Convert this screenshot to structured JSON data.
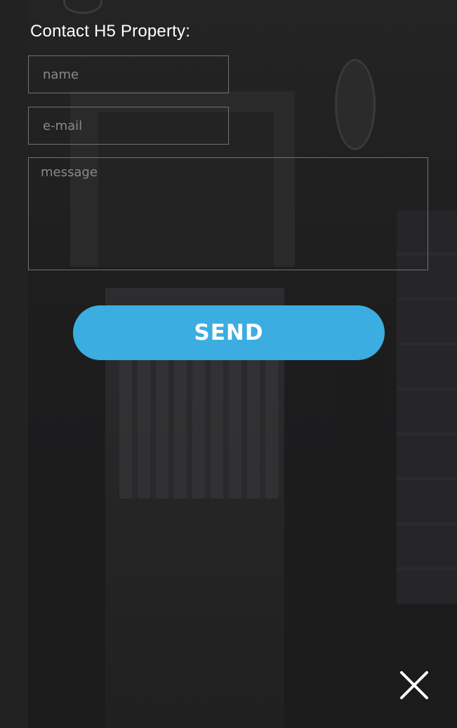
{
  "form": {
    "title": "Contact H5 Property:",
    "name_placeholder": "name",
    "email_placeholder": "e-mail",
    "message_placeholder": "message",
    "send_label": "SEND"
  },
  "close_icon": "close-icon",
  "colors": {
    "accent": "#3cade0",
    "overlay": "#1f1f20",
    "text": "#ffffff"
  }
}
